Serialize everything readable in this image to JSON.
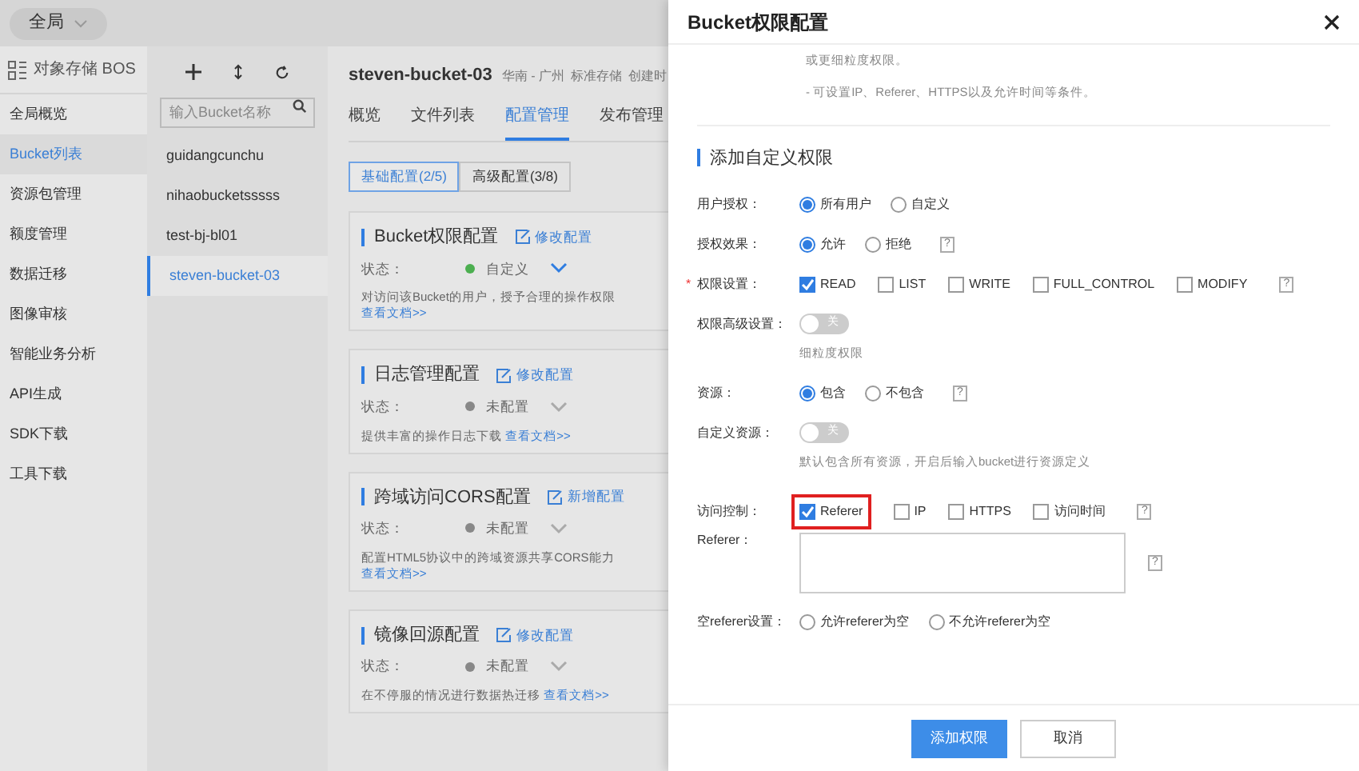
{
  "top_bar": {
    "scope": "全局"
  },
  "sidebar": {
    "title": "对象存储 BOS",
    "items": [
      {
        "label": "全局概览",
        "selected": false
      },
      {
        "label": "Bucket列表",
        "selected": true
      },
      {
        "label": "资源包管理",
        "selected": false
      },
      {
        "label": "额度管理",
        "selected": false
      },
      {
        "label": "数据迁移",
        "selected": false
      },
      {
        "label": "图像审核",
        "selected": false
      },
      {
        "label": "智能业务分析",
        "selected": false
      },
      {
        "label": "API生成",
        "selected": false
      },
      {
        "label": "SDK下载",
        "selected": false
      },
      {
        "label": "工具下载",
        "selected": false
      }
    ]
  },
  "bucket_list": {
    "search": {
      "placeholder": "输入Bucket名称"
    },
    "buckets": [
      {
        "name": "guidangcunchu",
        "selected": false
      },
      {
        "name": "nihaobucketsssss",
        "selected": false
      },
      {
        "name": "test-bj-bl01",
        "selected": false
      },
      {
        "name": "steven-bucket-03",
        "selected": true
      }
    ]
  },
  "detail": {
    "title": "steven-bucket-03",
    "meta": [
      "华南 - 广州",
      "标准存储",
      "创建时"
    ],
    "tabs": [
      {
        "label": "概览",
        "selected": false
      },
      {
        "label": "文件列表",
        "selected": false
      },
      {
        "label": "配置管理",
        "selected": true
      },
      {
        "label": "发布管理",
        "selected": false
      }
    ],
    "subtabs": [
      {
        "label": "基础配置(2/5)",
        "selected": true
      },
      {
        "label": "高级配置(3/8)",
        "selected": false
      }
    ],
    "cards": [
      {
        "title": "Bucket权限配置",
        "action": "修改配置",
        "status_label": "状态：",
        "status": "自定义",
        "configured": true,
        "description": "对访问该Bucket的用户，授予合理的操作权限",
        "link": "查看文档>>"
      },
      {
        "title": "日志管理配置",
        "action": "修改配置",
        "status_label": "状态：",
        "status": "未配置",
        "configured": false,
        "description": "提供丰富的操作日志下载",
        "link": "查看文档>>"
      },
      {
        "title": "跨域访问CORS配置",
        "action": "新增配置",
        "status_label": "状态：",
        "status": "未配置",
        "configured": false,
        "description": "配置HTML5协议中的跨域资源共享CORS能力",
        "link": "查看文档>>"
      },
      {
        "title": "镜像回源配置",
        "action": "修改配置",
        "status_label": "状态：",
        "status": "未配置",
        "configured": false,
        "description": "在不停服的情况进行数据热迁移",
        "link": "查看文档>>"
      }
    ]
  },
  "drawer": {
    "title": "Bucket权限配置",
    "intro": [
      "或更细粒度权限。",
      "- 可设置IP、Referer、HTTPS以及允许时间等条件。"
    ],
    "section_title": "添加自定义权限",
    "rows": [
      {
        "kind": "radio",
        "label": "用户授权：",
        "options": [
          {
            "label": "所有用户",
            "selected": true
          },
          {
            "label": "自定义",
            "selected": false
          }
        ]
      },
      {
        "kind": "radio",
        "label": "授权效果：",
        "help": "?",
        "options": [
          {
            "label": "允许",
            "selected": true
          },
          {
            "label": "拒绝",
            "selected": false
          }
        ]
      },
      {
        "kind": "checkbox",
        "label": "权限设置：",
        "required_mark": "*",
        "help": "?",
        "options": [
          {
            "label": "READ",
            "checked": true,
            "highlighted": false
          },
          {
            "label": "LIST",
            "checked": false,
            "highlighted": false
          },
          {
            "label": "WRITE",
            "checked": false,
            "highlighted": false
          },
          {
            "label": "FULL_CONTROL",
            "checked": false,
            "highlighted": false
          },
          {
            "label": "MODIFY",
            "checked": false,
            "highlighted": false
          }
        ]
      },
      {
        "kind": "toggle",
        "label": "权限高级设置：",
        "on": false,
        "toggle_label": "关",
        "hint": "细粒度权限"
      },
      {
        "kind": "radio",
        "label": "资源：",
        "help": "?",
        "options": [
          {
            "label": "包含",
            "selected": true
          },
          {
            "label": "不包含",
            "selected": false
          }
        ]
      },
      {
        "kind": "toggle",
        "label": "自定义资源：",
        "on": false,
        "toggle_label": "关",
        "hint": "默认包含所有资源，开启后输入bucket进行资源定义"
      },
      {
        "kind": "checkbox",
        "label": "访问控制：",
        "help": "?",
        "options": [
          {
            "label": "Referer",
            "checked": true,
            "highlighted": true
          },
          {
            "label": "IP",
            "checked": false,
            "highlighted": false
          },
          {
            "label": "HTTPS",
            "checked": false,
            "highlighted": false
          },
          {
            "label": "访问时间",
            "checked": false,
            "highlighted": false
          }
        ]
      },
      {
        "kind": "textarea",
        "label": "Referer：",
        "help": "?"
      },
      {
        "kind": "radio",
        "label": "空referer设置：",
        "options": [
          {
            "label": "允许referer为空",
            "selected": false
          },
          {
            "label": "不允许referer为空",
            "selected": false
          }
        ]
      }
    ],
    "buttons": [
      {
        "label": "添加权限",
        "kind": "primary"
      },
      {
        "label": "取消",
        "kind": "default"
      }
    ]
  }
}
